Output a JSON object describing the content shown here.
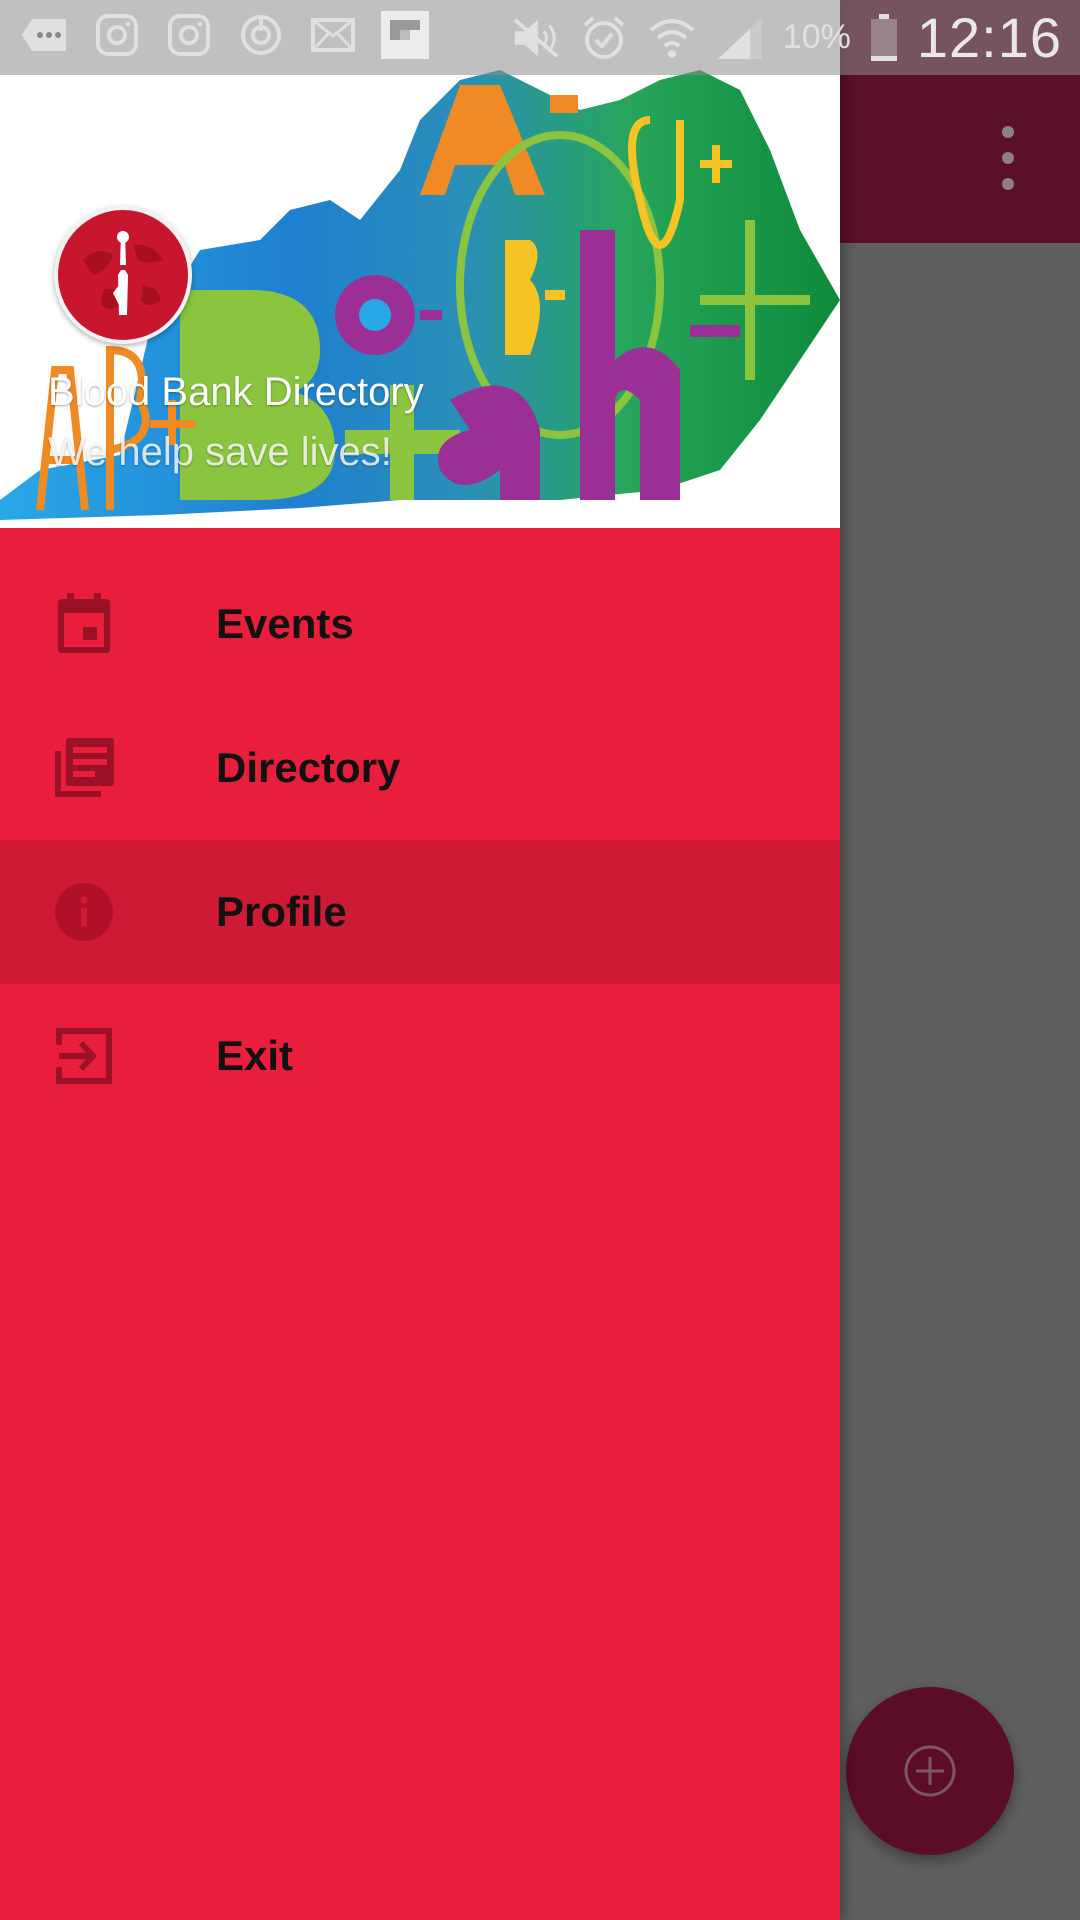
{
  "status_bar": {
    "battery_percent": "10%",
    "time": "12:16"
  },
  "drawer": {
    "header": {
      "title": "Blood Bank Directory",
      "subtitle": "We help save lives!"
    },
    "items": [
      {
        "label": "Events",
        "icon": "calendar-icon",
        "active": false
      },
      {
        "label": "Directory",
        "icon": "library-books-icon",
        "active": false
      },
      {
        "label": "Profile",
        "icon": "info-icon",
        "active": true
      },
      {
        "label": "Exit",
        "icon": "exit-icon",
        "active": false
      }
    ]
  },
  "colors": {
    "drawer_bg": "#e91e3c",
    "drawer_active": "#ce1a35",
    "app_bar": "#5b1029",
    "scrim": "#5f5f5f",
    "fab": "#5b0c26",
    "icon": "#9a1128"
  }
}
